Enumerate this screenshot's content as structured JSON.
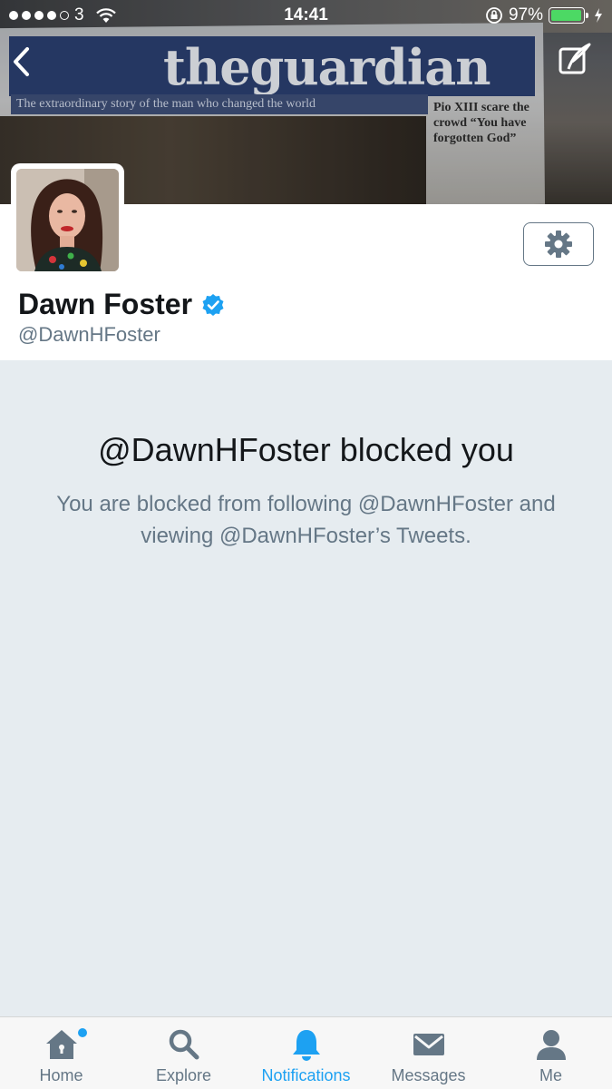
{
  "status_bar": {
    "carrier": "3",
    "time": "14:41",
    "battery": "97%",
    "battery_level": 0.97
  },
  "banner": {
    "masthead": "theguardian",
    "strap": "The extraordinary story of the man who changed the world",
    "side_story": "Pio XIII scare the crowd “You have forgotten God”"
  },
  "profile": {
    "name": "Dawn Foster",
    "handle": "@DawnHFoster",
    "verified": true
  },
  "blocked": {
    "title": "@DawnHFoster blocked you",
    "body": "You are blocked from following @DawnHFoster and viewing @DawnHFoster’s Tweets."
  },
  "tabbar": {
    "home": "Home",
    "explore": "Explore",
    "notifications": "Notifications",
    "messages": "Messages",
    "me": "Me"
  },
  "colors": {
    "accent": "#1da1f2",
    "muted": "#657786",
    "background": "#e6ecf0",
    "text": "#14171a"
  }
}
